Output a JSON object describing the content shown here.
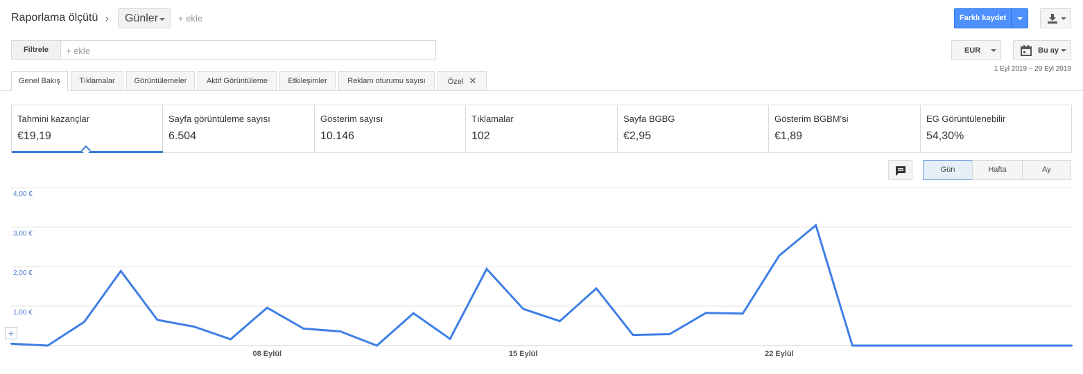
{
  "header": {
    "title": "Raporlama ölçütü",
    "chevron": "›",
    "dimension": "Günler",
    "add_dimension": "+ ekle",
    "save_label": "Farklı kaydet"
  },
  "filter": {
    "label": "Filtrele",
    "add": "+ ekle"
  },
  "currency": "EUR",
  "date": {
    "preset": "Bu ay",
    "range": "1 Eyl 2019 – 29 Eyl 2019"
  },
  "tabs": [
    {
      "label": "Genel Bakış"
    },
    {
      "label": "Tıklamalar"
    },
    {
      "label": "Görüntülemeler"
    },
    {
      "label": "Aktif Görüntüleme"
    },
    {
      "label": "Etkileşimler"
    },
    {
      "label": "Reklam oturumu sayısı"
    },
    {
      "label": "Özel",
      "close": "✕"
    }
  ],
  "scorecards": [
    {
      "label": "Tahmini kazançlar",
      "value": "€19,19"
    },
    {
      "label": "Sayfa görüntüleme sayısı",
      "value": "6.504"
    },
    {
      "label": "Gösterim sayısı",
      "value": "10.146"
    },
    {
      "label": "Tıklamalar",
      "value": "102"
    },
    {
      "label": "Sayfa BGBG",
      "value": "€2,95"
    },
    {
      "label": "Gösterim BGBM'si",
      "value": "€1,89"
    },
    {
      "label": "EG Görüntülenebilir",
      "value": "54,30%"
    }
  ],
  "granularity": [
    {
      "label": "Gün"
    },
    {
      "label": "Hafta"
    },
    {
      "label": "Ay"
    }
  ],
  "add_annotation": "+",
  "colors": {
    "accent": "#4d90fe",
    "line": "#3f7fe6",
    "axis_label": "#4a79c9"
  },
  "chart_data": {
    "type": "line",
    "title": "",
    "xlabel": "",
    "ylabel": "",
    "ylim": [
      0,
      4
    ],
    "y_ticks": [
      "1,00 €",
      "2,00 €",
      "3,00 €",
      "4,00 €"
    ],
    "x_tick_labels": [
      {
        "day": 8,
        "label": "08 Eylül"
      },
      {
        "day": 15,
        "label": "15 Eylül"
      },
      {
        "day": 22,
        "label": "22 Eylül"
      }
    ],
    "x": [
      1,
      2,
      3,
      4,
      5,
      6,
      7,
      8,
      9,
      10,
      11,
      12,
      13,
      14,
      15,
      16,
      17,
      18,
      19,
      20,
      21,
      22,
      23,
      24,
      25,
      26,
      27,
      28,
      29,
      30
    ],
    "series": [
      {
        "values": [
          0.05,
          0.0,
          0.6,
          1.89,
          0.65,
          0.48,
          0.16,
          0.96,
          0.43,
          0.36,
          0.0,
          0.82,
          0.17,
          1.94,
          0.93,
          0.62,
          1.45,
          0.27,
          0.29,
          0.83,
          0.81,
          2.28,
          3.05,
          0,
          0,
          0,
          0,
          0,
          0,
          0
        ]
      }
    ]
  }
}
